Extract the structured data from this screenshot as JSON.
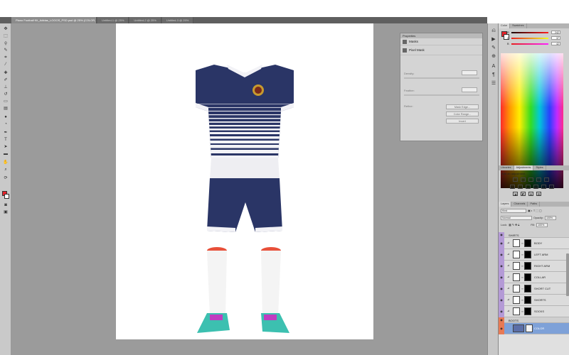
{
  "tabs": [
    {
      "label": "Plano Football Kit_Adidas_LOGOS_PSD.psd @ 25% (COLOR, RGB/8#)",
      "active": true
    },
    {
      "label": "Untitled-1 @ 25%",
      "active": false
    },
    {
      "label": "Untitled-2 @ 25%",
      "active": false
    },
    {
      "label": "Untitled-3 @ 25%",
      "active": false
    }
  ],
  "properties": {
    "title": "Properties",
    "subtitle": "Masks",
    "mask_label": "Pixel Mask",
    "density_label": "Density:",
    "feather_label": "Feather:",
    "refine_label": "Refine:",
    "buttons": [
      "Mask Edge...",
      "Color Range...",
      "Invert"
    ]
  },
  "color_panel": {
    "tabs": [
      "Color",
      "Swatches"
    ],
    "sliders": [
      {
        "label": "R",
        "value": "242",
        "color": "#d42020"
      },
      {
        "label": "G",
        "value": "37",
        "color": "#20b020"
      },
      {
        "label": "B",
        "value": "42",
        "color": "#2040d4"
      }
    ]
  },
  "adjustments": {
    "tabs": [
      "Libraries",
      "Adjustments",
      "Styles"
    ],
    "title": "Add an adjustment",
    "row1": [
      "☀",
      "▥",
      "◐",
      "▦",
      "▽"
    ],
    "row2": [
      "◧",
      "⚖",
      "◑",
      "▣",
      "●",
      "▦"
    ],
    "row3": [
      "◪",
      "◩",
      "▤",
      "▧"
    ]
  },
  "layers_panel": {
    "tabs": [
      "Layers",
      "Channels",
      "Paths"
    ],
    "kind": "Kind",
    "blend_mode": "Normal",
    "opacity_label": "Opacity:",
    "opacity_value": "100%",
    "lock_label": "Lock:",
    "fill_label": "Fill:",
    "fill_value": "100%",
    "layers": [
      {
        "name": "SHIRTS",
        "type": "group"
      },
      {
        "name": "BODY",
        "type": "layer"
      },
      {
        "name": "LEFT ARM",
        "type": "layer"
      },
      {
        "name": "RIGHT ARM",
        "type": "layer"
      },
      {
        "name": "COLLAR",
        "type": "layer"
      },
      {
        "name": "SHORT CUT",
        "type": "layer"
      },
      {
        "name": "SHORTS",
        "type": "layer"
      },
      {
        "name": "SOCKS",
        "type": "layer"
      },
      {
        "name": "BOOTS",
        "type": "folder"
      },
      {
        "name": "COLOR",
        "type": "selected"
      }
    ]
  },
  "colors": {
    "navy": "#2a3566",
    "stripe_white": "#f2f2f6",
    "sock_top": "#e8503a",
    "boot": "#3cc0b0",
    "lace": "#c03cc0",
    "crest": "#c79a2e"
  }
}
